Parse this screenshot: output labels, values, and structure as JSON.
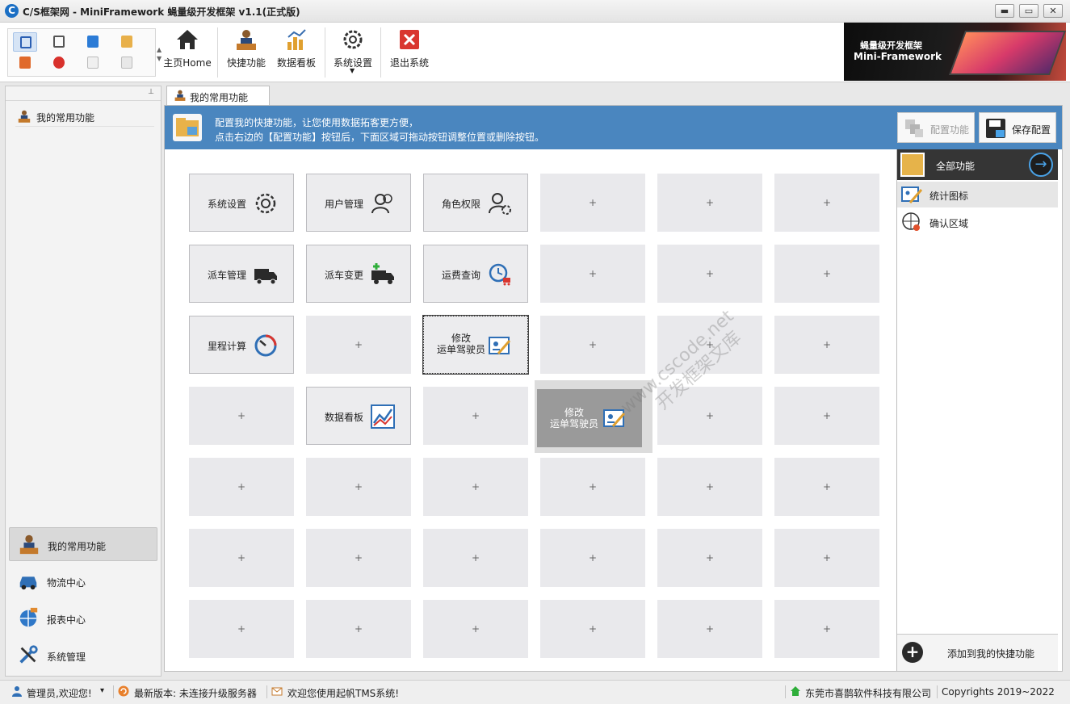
{
  "window": {
    "title": "C/S框架网 - MiniFramework 蝇量级开发框架 v1.1(正式版)",
    "min_glyph": "▬",
    "max_glyph": "▭",
    "close_glyph": "✕"
  },
  "toolbar": {
    "home_label": "主页Home",
    "shortcut_label": "快捷功能",
    "dashboard_label": "数据看板",
    "settings_label": "系统设置",
    "exit_label": "退出系统",
    "banner_title": "蝇量级开发框架",
    "banner_subtitle": "Mini-Framework"
  },
  "left_panel": {
    "pin_glyph": "⊥",
    "top_item": "我的常用功能",
    "nav": [
      {
        "label": "我的常用功能",
        "icon": "person-desk-icon",
        "active": true
      },
      {
        "label": "物流中心",
        "icon": "car-icon",
        "active": false
      },
      {
        "label": "报表中心",
        "icon": "globe-icon",
        "active": false
      },
      {
        "label": "系统管理",
        "icon": "tools-icon",
        "active": false
      }
    ]
  },
  "tab": {
    "label": "我的常用功能"
  },
  "infobar": {
    "line1": "配置我的快捷功能，让您使用数据拓客更方便，",
    "line2": "点击右边的【配置功能】按钮后，下面区域可拖动按钮调整位置或删除按钮。",
    "config_button": "配置功能",
    "save_button": "保存配置"
  },
  "grid": {
    "empty_label": "+",
    "functions": {
      "r0c0": "系统设置",
      "r0c1": "用户管理",
      "r0c2": "角色权限",
      "r1c0": "派车管理",
      "r1c1": "派车变更",
      "r1c2": "运费查询",
      "r2c0": "里程计算",
      "r2c2_a": "修改",
      "r2c2_b": "运单驾驶员",
      "r3c1": "数据看板"
    },
    "ghost_a": "修改",
    "ghost_b": "运单驾驶员"
  },
  "watermark": {
    "line1": "www.cscode.net",
    "line2": "开发框架文库"
  },
  "right_panel": {
    "header": "全部功能",
    "go_glyph": "→",
    "items": [
      "统计图标",
      "确认区域"
    ],
    "add_glyph": "+",
    "add_label": "添加到我的快捷功能"
  },
  "statusbar": {
    "user": "管理员,欢迎您!",
    "dropdown_glyph": "▾",
    "version": "最新版本: 未连接升级服务器",
    "welcome": "欢迎您使用起帆TMS系统!",
    "company": "东莞市喜鹊软件科技有限公司",
    "copyright": "Copyrights 2019~2022"
  },
  "colors": {
    "accent": "#4a86bf",
    "cell_bg": "#e9e9ec",
    "panel_head": "#353535"
  }
}
